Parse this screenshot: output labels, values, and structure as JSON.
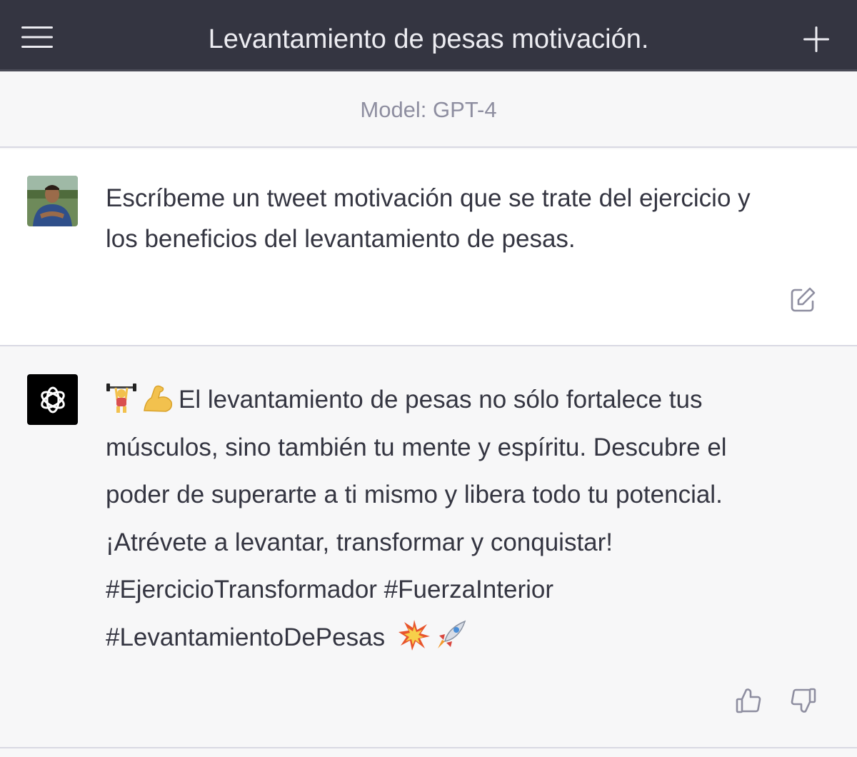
{
  "header": {
    "title": "Levantamiento de pesas motivación.",
    "menu_icon": "hamburger-menu-icon",
    "new_chat_icon": "plus-icon"
  },
  "model_bar": {
    "label": "Model: GPT-4"
  },
  "conversation": {
    "user_message": {
      "lines": [
        "Escríbeme un tweet motivación que se trate del ejercicio y",
        "los beneficios del levantamiento de pesas."
      ],
      "edit_icon": "edit-icon"
    },
    "assistant_message": {
      "lines": [
        "El levantamiento de pesas no sólo fortalece tus",
        "músculos, sino también tu mente y espíritu. Descubre el",
        "poder de superarte a ti mismo y libera todo tu potencial.",
        "¡Atrévete a levantar, transformar y conquistar!",
        "#EjercicioTransformador #FuerzaInterior",
        "#LevantamientoDePesas"
      ],
      "leading_emojis": [
        "weightlifter-emoji",
        "flexed-biceps-emoji"
      ],
      "trailing_emojis": [
        "collision-emoji",
        "rocket-emoji"
      ],
      "feedback_icons": [
        "thumbs-up-icon",
        "thumbs-down-icon"
      ]
    }
  },
  "colors": {
    "header_bg": "#343541",
    "header_text": "#ececf1",
    "page_bg": "#f7f7f8",
    "user_bg": "#ffffff",
    "muted": "#8e8ea0",
    "text": "#343541"
  }
}
